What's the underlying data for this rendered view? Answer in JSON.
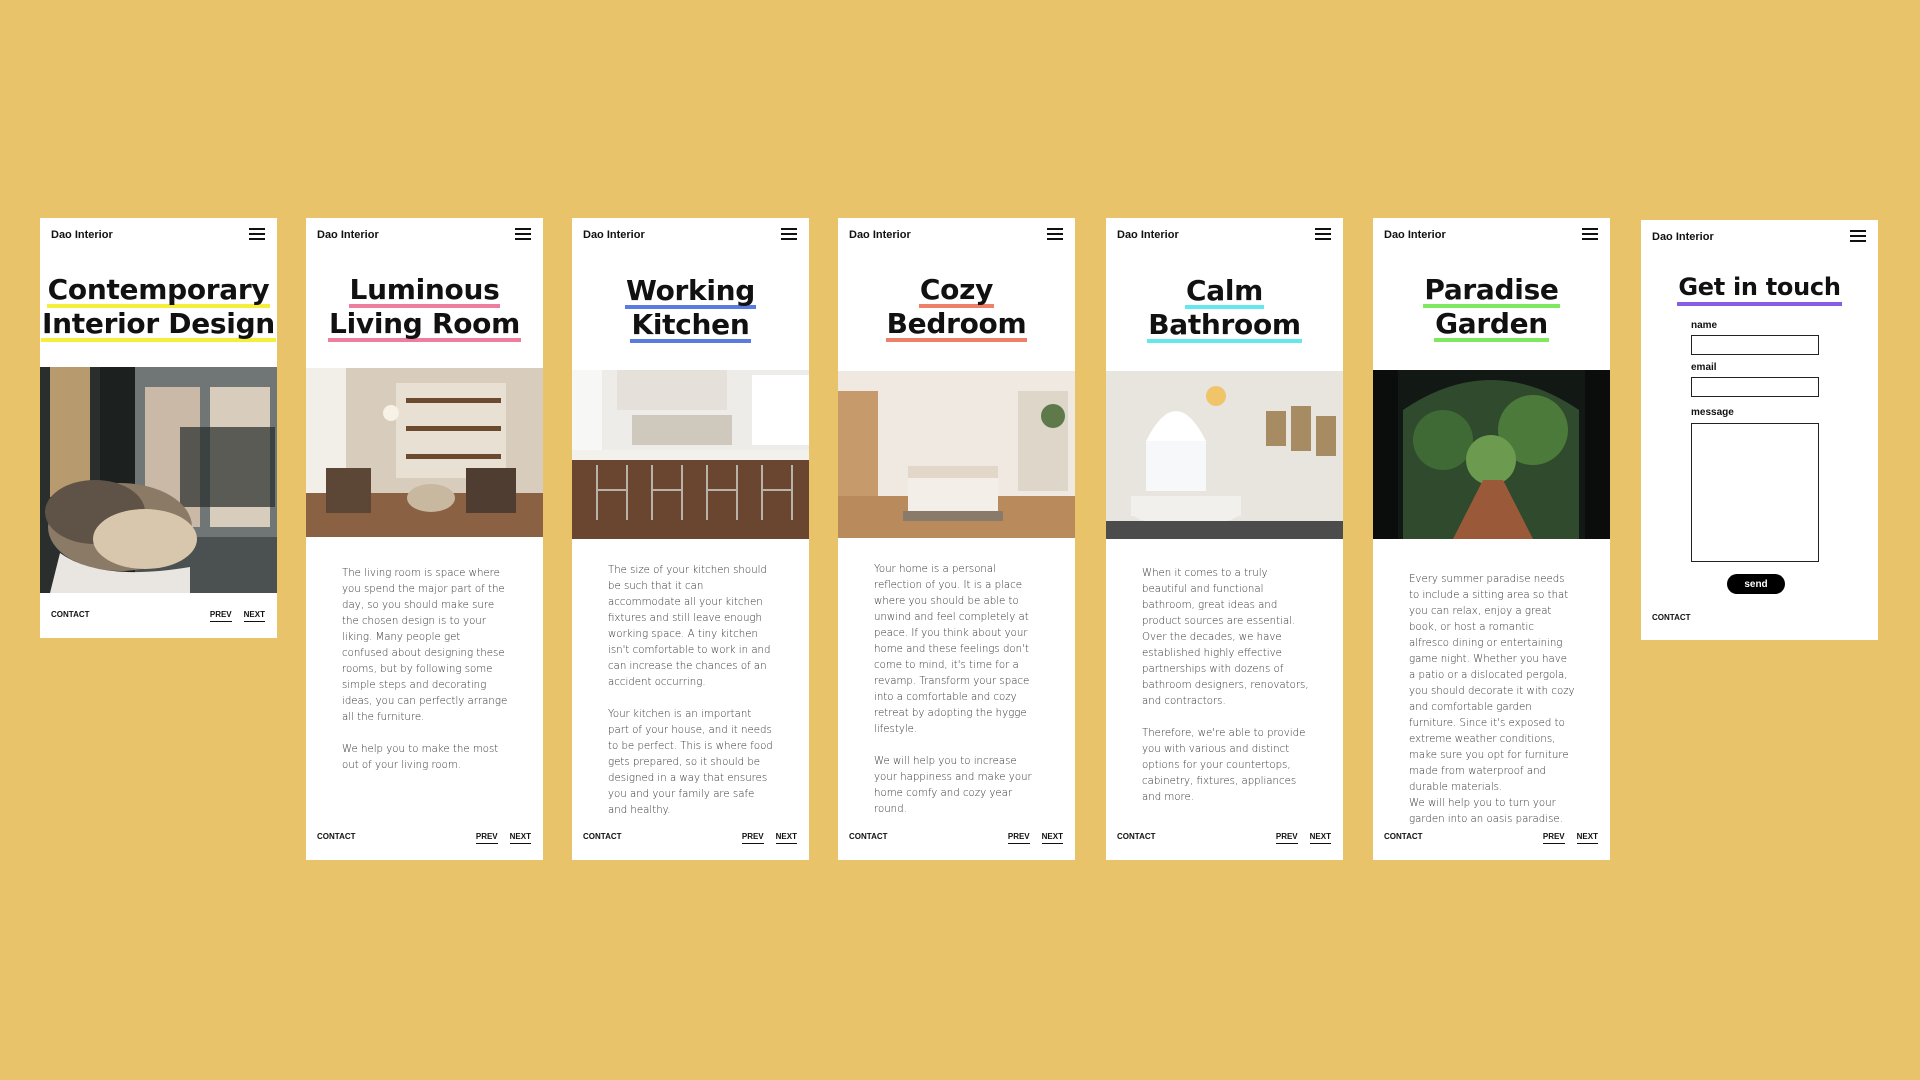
{
  "brand": "Dao Interior",
  "footer": {
    "contact": "CONTACT",
    "prev": "PREV",
    "next": "NEXT"
  },
  "colors": {
    "background": "#E8C36A",
    "accent_yellow": "#F5EE3A",
    "accent_pink": "#EE7E9E",
    "accent_blue": "#5A7BE0",
    "accent_coral": "#EE7F68",
    "accent_cyan": "#64E8EE",
    "accent_green": "#7EE85E",
    "accent_purple": "#8A5CE6"
  },
  "cards": [
    {
      "title_lines": [
        "Contemporary",
        "Interior Design"
      ],
      "photo_icon": "armchair-window-photo"
    },
    {
      "title_lines": [
        "Luminous",
        "Living Room"
      ],
      "photo_icon": "living-room-photo",
      "paragraphs": [
        "The living room is space where you spend the major part of the day, so you should make sure the chosen design is to your liking. Many people get confused about designing these rooms, but by following some simple steps and decorating ideas, you can perfectly arrange all the furniture.",
        "We help you to make the most out of your living room."
      ]
    },
    {
      "title_lines": [
        "Working",
        "Kitchen"
      ],
      "photo_icon": "kitchen-photo",
      "paragraphs": [
        "The size of your kitchen should be such that it can accommodate all your kitchen fixtures and still leave enough working space. A tiny kitchen isn't comfortable to work in and can increase the chances of an accident occurring.",
        "Your kitchen is an important part of your house, and it needs to be perfect. This is where food gets prepared, so it should be designed in a way that ensures you and your family are safe and healthy."
      ]
    },
    {
      "title_lines": [
        "Cozy",
        "Bedroom"
      ],
      "photo_icon": "bedroom-photo",
      "paragraphs": [
        "Your home is a personal reflection of you. It is a place where you should be able to unwind and feel completely at peace. If you think about your home and these feelings don't come to mind, it's time for a revamp. Transform your space into a comfortable and cozy retreat by adopting the hygge lifestyle.",
        "We will help you to increase your happiness and make your home comfy and cozy year round."
      ]
    },
    {
      "title_lines": [
        "Calm",
        "Bathroom"
      ],
      "photo_icon": "bathroom-photo",
      "paragraphs": [
        "When it comes to a truly beautiful and functional bathroom, great ideas and product sources are essential. Over the decades, we have established highly effective partnerships with dozens of bathroom designers, renovators, and contractors.",
        "Therefore, we're able to provide you with various and distinct options for your countertops, cabinetry, fixtures, appliances and more."
      ]
    },
    {
      "title_lines": [
        "Paradise",
        "Garden"
      ],
      "photo_icon": "garden-photo",
      "paragraphs": [
        "Every summer paradise needs to include a sitting area so that you can relax, enjoy a great book, or host a romantic alfresco dining or entertaining game night. Whether you have a patio or a dislocated pergola, you should decorate it with cozy and comfortable garden furniture. Since it's exposed to extreme weather conditions, make sure you opt for furniture made from waterproof and durable materials.",
        "We will help you to turn your garden into an oasis paradise."
      ]
    }
  ],
  "contact_card": {
    "title": "Get in touch",
    "name_label": "name",
    "email_label": "email",
    "message_label": "message",
    "send_label": "send"
  }
}
